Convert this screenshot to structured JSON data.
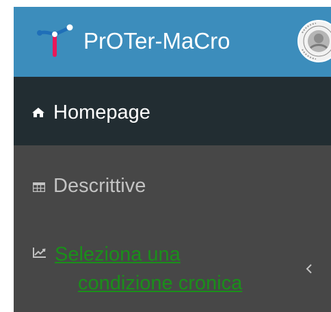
{
  "brand": {
    "title": "PrOTer-MaCro",
    "logo_icon": "molecule-logo-icon",
    "seal_icon": "university-seal-icon",
    "bar_color": "#3c8dbc"
  },
  "menu": {
    "home": {
      "label": "Homepage",
      "icon": "home-icon",
      "active": true
    },
    "descriptive": {
      "label": "Descrittive",
      "icon": "table-icon"
    },
    "condition": {
      "line1": "Seleziona una",
      "line2": "condizione cronica",
      "icon": "line-chart-icon",
      "toggle_icon": "chevron-left-icon",
      "link_color": "#1a8f1a"
    }
  },
  "colors": {
    "active_bg": "#222d32",
    "sidebar_bg": "#474747",
    "muted_text": "#c3c3c3"
  }
}
